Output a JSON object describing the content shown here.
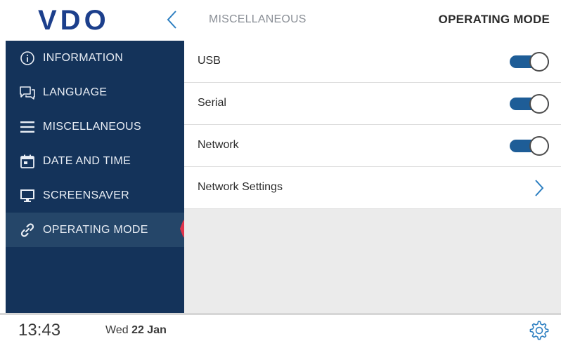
{
  "header": {
    "logo_text": "VDO",
    "breadcrumb": "MISCELLANEOUS",
    "title": "OPERATING MODE",
    "back_icon": "chevron-left-icon"
  },
  "sidebar": {
    "items": [
      {
        "label": "INFORMATION",
        "icon": "info-icon"
      },
      {
        "label": "LANGUAGE",
        "icon": "chat-icon"
      },
      {
        "label": "MISCELLANEOUS",
        "icon": "menu-icon"
      },
      {
        "label": "DATE AND TIME",
        "icon": "calendar-icon"
      },
      {
        "label": "SCREENSAVER",
        "icon": "monitor-icon"
      },
      {
        "label": "OPERATING MODE",
        "icon": "link-icon",
        "active": true
      }
    ]
  },
  "settings": {
    "rows": [
      {
        "label": "USB",
        "control": "toggle",
        "on": true
      },
      {
        "label": "Serial",
        "control": "toggle",
        "on": true
      },
      {
        "label": "Network",
        "control": "toggle",
        "on": true
      },
      {
        "label": "Network Settings",
        "control": "chevron"
      }
    ]
  },
  "footer": {
    "time": "13:43",
    "day": "Wed",
    "date": "22 Jan",
    "settings_icon": "gear-icon"
  },
  "colors": {
    "sidebar_bg": "#14335a",
    "sidebar_active_bg": "#254669",
    "accent_blue": "#1e5d97",
    "active_marker": "#e0344c",
    "logo_blue": "#1c3f8c"
  }
}
